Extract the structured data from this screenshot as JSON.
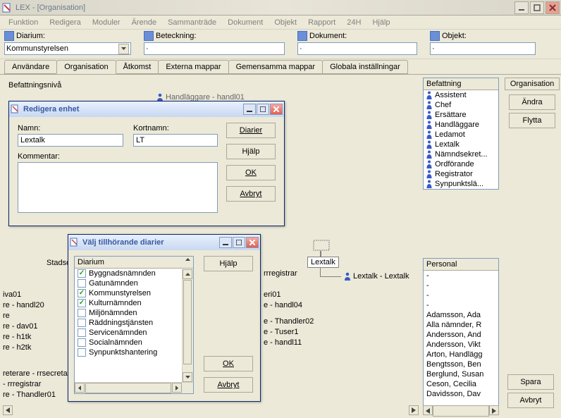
{
  "window": {
    "title": "LEX - [Organisation]"
  },
  "menu": [
    "Funktion",
    "Redigera",
    "Moduler",
    "Ärende",
    "Sammanträde",
    "Dokument",
    "Objekt",
    "Rapport",
    "24H",
    "Hjälp"
  ],
  "toolbar": {
    "diarium": {
      "label": "Diarium:",
      "value": "Kommunstyrelsen"
    },
    "beteckning": {
      "label": "Beteckning:",
      "value": "·"
    },
    "dokument": {
      "label": "Dokument:",
      "value": "·"
    },
    "objekt": {
      "label": "Objekt:",
      "value": "·"
    }
  },
  "tabs": [
    "Användare",
    "Organisation",
    "Åtkomst",
    "Externa mappar",
    "Gemensamma mappar",
    "Globala inställningar"
  ],
  "active_tab": 1,
  "group_label": "Befattningsnivå",
  "right_panel": {
    "title": "Organisation",
    "andra": "Ändra",
    "flytta": "Flytta",
    "spara": "Spara",
    "avbryt": "Avbryt"
  },
  "befattning": {
    "title": "Befattning",
    "items": [
      "Assistent",
      "Chef",
      "Ersättare",
      "Handläggare",
      "Ledamot",
      "Lextalk",
      "Nämndsekret...",
      "Ordförande",
      "Registrator",
      "Synpunktslä..."
    ]
  },
  "tree": {
    "top_partial": "Handläggare - handl01",
    "left_items": [
      "Stadsd",
      "iva01",
      "re - handl20",
      "re",
      "re - dav01",
      "re - h1tk",
      "re - h2tk",
      "reterare - rrsecreta",
      "- rrregistrar",
      "re - Thandler01"
    ],
    "mid_items": [
      "rrregistrar",
      "eri01",
      "e - handl04",
      "e - Thandler02",
      "e - Tuser1",
      "e - handl11"
    ],
    "lextalk_box": "Lextalk",
    "lextalk_item": "Lextalk - Lextalk"
  },
  "personal": {
    "title": "Personal",
    "items": [
      "-",
      "-",
      "-",
      "-",
      "Adamsson, Ada",
      "Alla nämnder, R",
      "Andersson, And",
      "Andersson, Vikt",
      "Arton, Handlägg",
      "Bengtsson, Ben",
      "Berglund, Susan",
      "Ceson, Cecilia",
      "Davidsson, Dav"
    ]
  },
  "dlg_edit": {
    "title": "Redigera enhet",
    "namn_label": "Namn:",
    "namn_value": "Lextalk",
    "kortnamn_label": "Kortnamn:",
    "kortnamn_value": "LT",
    "kommentar_label": "Kommentar:",
    "btn_diarier": "Diarier",
    "btn_hjalp": "Hjälp",
    "btn_ok": "OK",
    "btn_avbryt": "Avbryt"
  },
  "dlg_select": {
    "title": "Välj tillhörande diarier",
    "header": "Diarium",
    "items": [
      {
        "label": "Byggnadsnämnden",
        "checked": true
      },
      {
        "label": "Gatunämnden",
        "checked": false
      },
      {
        "label": "Kommunstyrelsen",
        "checked": true
      },
      {
        "label": "Kulturnämnden",
        "checked": true
      },
      {
        "label": "Miljönämnden",
        "checked": false
      },
      {
        "label": "Räddningstjänsten",
        "checked": false
      },
      {
        "label": "Servicenämnden",
        "checked": false
      },
      {
        "label": "Socialnämnden",
        "checked": false
      },
      {
        "label": "Synpunktshantering",
        "checked": false
      }
    ],
    "btn_hjalp": "Hjälp",
    "btn_ok": "OK",
    "btn_avbryt": "Avbryt"
  }
}
